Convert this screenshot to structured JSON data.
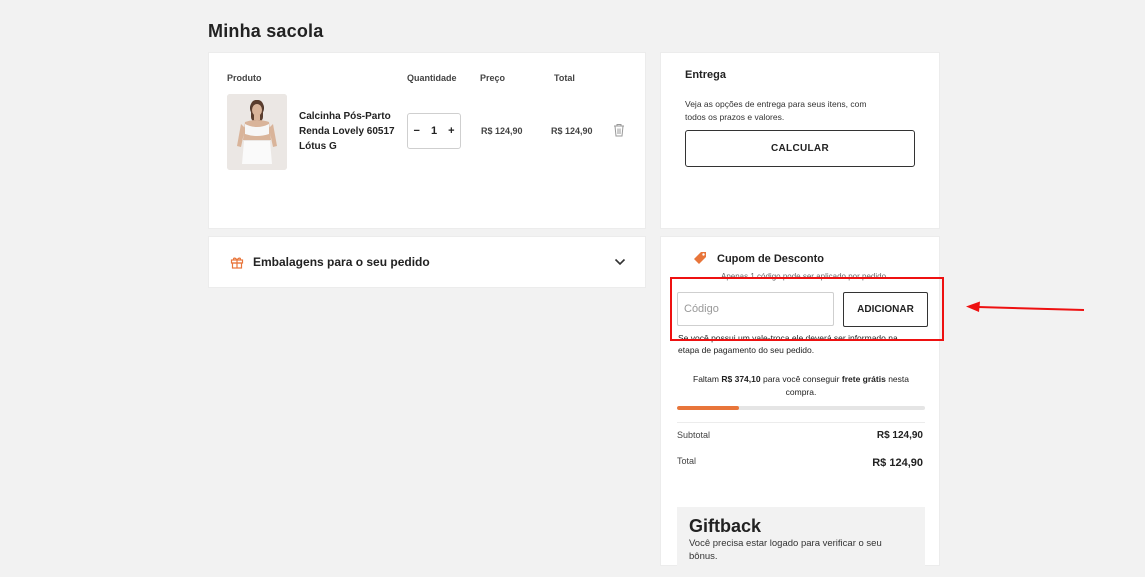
{
  "page": {
    "title": "Minha sacola"
  },
  "cart": {
    "headers": {
      "product": "Produto",
      "quantity": "Quantidade",
      "price": "Preço",
      "total": "Total"
    },
    "items": [
      {
        "name": "Calcinha Pós-Parto Renda Lovely 60517 Lótus G",
        "quantity": "1",
        "price": "R$ 124,90",
        "total": "R$ 124,90"
      }
    ],
    "qty_minus": "−",
    "qty_plus": "+"
  },
  "packaging": {
    "label": "Embalagens para o seu pedido",
    "icon": "gift-icon"
  },
  "delivery": {
    "title": "Entrega",
    "description": "Veja as opções de entrega para seus itens, com todos os prazos e valores.",
    "button": "CALCULAR"
  },
  "coupon": {
    "title": "Cupom de Desconto",
    "hint": "Apenas 1 código pode ser aplicado por pedido.",
    "placeholder": "Código",
    "button": "ADICIONAR",
    "vale_text": "Se você possui um vale-troca ele deverá ser informado na etapa de pagamento do seu pedido."
  },
  "shipping": {
    "before": "Faltam",
    "amount": "R$ 374,10",
    "middle": "para você conseguir",
    "free": "frete grátis",
    "after": "nesta compra.",
    "progress_percent": 25
  },
  "summary": {
    "subtotal_label": "Subtotal",
    "subtotal_value": "R$ 124,90",
    "total_label": "Total",
    "total_value": "R$ 124,90"
  },
  "giftback": {
    "title": "Giftback",
    "text": "Você precisa estar logado para verificar o seu bônus."
  },
  "colors": {
    "accent": "#e8753a",
    "highlight": "#e11111"
  }
}
